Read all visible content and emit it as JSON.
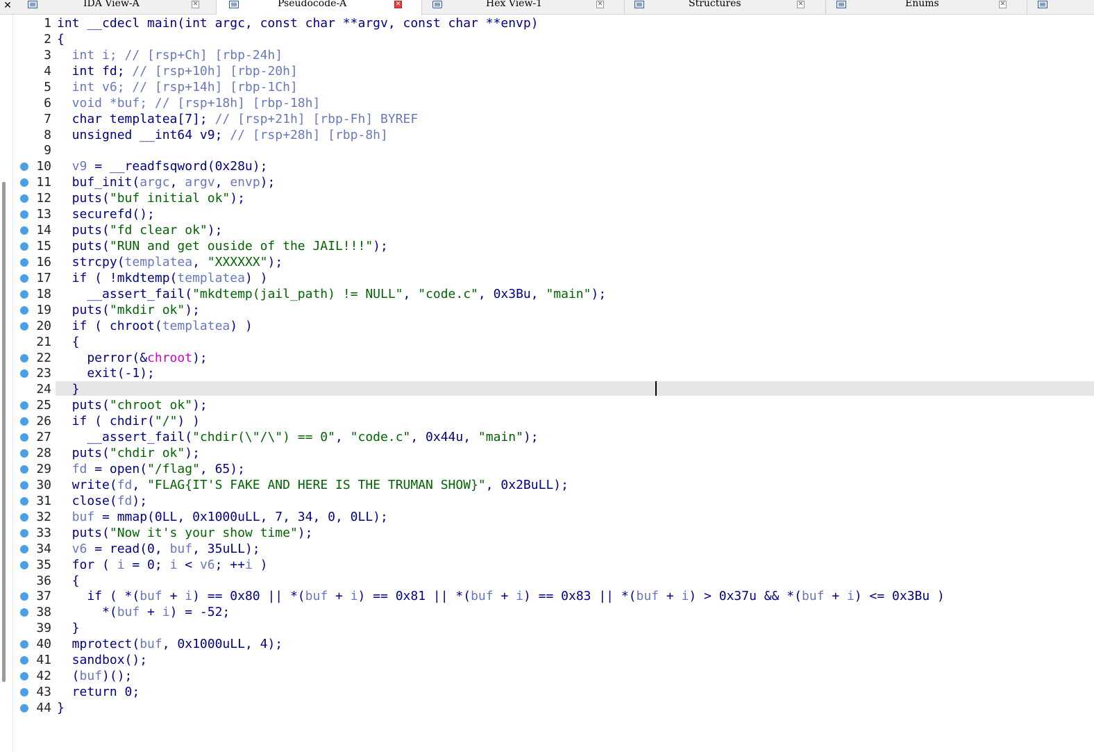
{
  "tabs": [
    {
      "label": "IDA View-A",
      "icon": "ida-view-icon",
      "active": false
    },
    {
      "label": "Pseudocode-A",
      "icon": "pseudocode-icon",
      "active": true
    },
    {
      "label": "Hex View-1",
      "icon": "hex-view-icon",
      "active": false
    },
    {
      "label": "Structures",
      "icon": "structures-icon",
      "active": false
    },
    {
      "label": "Enums",
      "icon": "enums-icon",
      "active": false
    }
  ],
  "colors": {
    "keyword": "#00008b",
    "variable": "#6878c0",
    "string": "#006400",
    "import": "#d000d0",
    "breakpoint": "#4aa0e8",
    "current_line": "#e6e6e6"
  },
  "lines": [
    {
      "n": "1",
      "bp": false,
      "t": [
        [
          "int __cdecl main(int argc, const char **argv, const char **envp)",
          "k"
        ]
      ]
    },
    {
      "n": "2",
      "bp": false,
      "t": [
        [
          "{",
          "k"
        ]
      ]
    },
    {
      "n": "3",
      "bp": false,
      "t": [
        [
          "  int i; // [rsp+Ch] [rbp-24h]",
          "g"
        ]
      ]
    },
    {
      "n": "4",
      "bp": false,
      "t": [
        [
          "  int fd; ",
          "k"
        ],
        [
          "// [rsp+10h] [rbp-20h]",
          "g"
        ]
      ]
    },
    {
      "n": "5",
      "bp": false,
      "t": [
        [
          "  int v6; // [rsp+14h] [rbp-1Ch]",
          "g"
        ]
      ]
    },
    {
      "n": "6",
      "bp": false,
      "t": [
        [
          "  void *buf; // [rsp+18h] [rbp-18h]",
          "g"
        ]
      ]
    },
    {
      "n": "7",
      "bp": false,
      "t": [
        [
          "  char templatea[7]; ",
          "k"
        ],
        [
          "// [rsp+21h] [rbp-Fh] BYREF",
          "g"
        ]
      ]
    },
    {
      "n": "8",
      "bp": false,
      "t": [
        [
          "  unsigned __int64 v9; ",
          "k"
        ],
        [
          "// [rsp+28h] [rbp-8h]",
          "g"
        ]
      ]
    },
    {
      "n": "9",
      "bp": false,
      "t": [
        [
          "",
          ""
        ]
      ]
    },
    {
      "n": "10",
      "bp": true,
      "t": [
        [
          "  v9",
          "g"
        ],
        [
          " = __readfsqword(0x28u);",
          "k"
        ]
      ]
    },
    {
      "n": "11",
      "bp": true,
      "t": [
        [
          "  buf_init(",
          "k"
        ],
        [
          "argc",
          "g"
        ],
        [
          ", ",
          "k"
        ],
        [
          "argv",
          "g"
        ],
        [
          ", ",
          "k"
        ],
        [
          "envp",
          "g"
        ],
        [
          ");",
          "k"
        ]
      ]
    },
    {
      "n": "12",
      "bp": true,
      "t": [
        [
          "  puts(",
          "k"
        ],
        [
          "\"buf initial ok\"",
          "s"
        ],
        [
          ");",
          "k"
        ]
      ]
    },
    {
      "n": "13",
      "bp": true,
      "t": [
        [
          "  securefd();",
          "k"
        ]
      ]
    },
    {
      "n": "14",
      "bp": true,
      "t": [
        [
          "  puts(",
          "k"
        ],
        [
          "\"fd clear ok\"",
          "s"
        ],
        [
          ");",
          "k"
        ]
      ]
    },
    {
      "n": "15",
      "bp": true,
      "t": [
        [
          "  puts(",
          "k"
        ],
        [
          "\"RUN and get ouside of the JAIL!!!\"",
          "s"
        ],
        [
          ");",
          "k"
        ]
      ]
    },
    {
      "n": "16",
      "bp": true,
      "t": [
        [
          "  strcpy(",
          "k"
        ],
        [
          "templatea",
          "g"
        ],
        [
          ", ",
          "k"
        ],
        [
          "\"XXXXXX\"",
          "s"
        ],
        [
          ");",
          "k"
        ]
      ]
    },
    {
      "n": "17",
      "bp": true,
      "t": [
        [
          "  if ( !mkdtemp(",
          "k"
        ],
        [
          "templatea",
          "g"
        ],
        [
          ") )",
          "k"
        ]
      ]
    },
    {
      "n": "18",
      "bp": true,
      "t": [
        [
          "    __assert_fail(",
          "k"
        ],
        [
          "\"mkdtemp(jail_path) != NULL\"",
          "s"
        ],
        [
          ", ",
          "k"
        ],
        [
          "\"code.c\"",
          "s"
        ],
        [
          ", 0x3Bu, ",
          "k"
        ],
        [
          "\"main\"",
          "s"
        ],
        [
          ");",
          "k"
        ]
      ]
    },
    {
      "n": "19",
      "bp": true,
      "t": [
        [
          "  puts(",
          "k"
        ],
        [
          "\"mkdir ok\"",
          "s"
        ],
        [
          ");",
          "k"
        ]
      ]
    },
    {
      "n": "20",
      "bp": true,
      "t": [
        [
          "  if ( chroot(",
          "k"
        ],
        [
          "templatea",
          "g"
        ],
        [
          ") )",
          "k"
        ]
      ]
    },
    {
      "n": "21",
      "bp": false,
      "t": [
        [
          "  {",
          "k"
        ]
      ]
    },
    {
      "n": "22",
      "bp": true,
      "t": [
        [
          "    perror(&",
          "k"
        ],
        [
          "chroot",
          "p"
        ],
        [
          ");",
          "k"
        ]
      ]
    },
    {
      "n": "23",
      "bp": true,
      "t": [
        [
          "    exit(-1);",
          "k"
        ]
      ]
    },
    {
      "n": "24",
      "bp": false,
      "t": [
        [
          "  }",
          "k"
        ]
      ]
    },
    {
      "n": "25",
      "bp": true,
      "t": [
        [
          "  puts(",
          "k"
        ],
        [
          "\"chroot ok\"",
          "s"
        ],
        [
          ");",
          "k"
        ]
      ]
    },
    {
      "n": "26",
      "bp": true,
      "t": [
        [
          "  if ( chdir(",
          "k"
        ],
        [
          "\"/\"",
          "s"
        ],
        [
          ") )",
          "k"
        ]
      ]
    },
    {
      "n": "27",
      "bp": true,
      "t": [
        [
          "    __assert_fail(",
          "k"
        ],
        [
          "\"chdir(\\\"/\\\") == 0\"",
          "s"
        ],
        [
          ", ",
          "k"
        ],
        [
          "\"code.c\"",
          "s"
        ],
        [
          ", 0x44u, ",
          "k"
        ],
        [
          "\"main\"",
          "s"
        ],
        [
          ");",
          "k"
        ]
      ]
    },
    {
      "n": "28",
      "bp": true,
      "t": [
        [
          "  puts(",
          "k"
        ],
        [
          "\"chdir ok\"",
          "s"
        ],
        [
          ");",
          "k"
        ]
      ]
    },
    {
      "n": "29",
      "bp": true,
      "t": [
        [
          "  fd",
          "g"
        ],
        [
          " = open(",
          "k"
        ],
        [
          "\"/flag\"",
          "s"
        ],
        [
          ", 65);",
          "k"
        ]
      ]
    },
    {
      "n": "30",
      "bp": true,
      "t": [
        [
          "  write(",
          "k"
        ],
        [
          "fd",
          "g"
        ],
        [
          ", ",
          "k"
        ],
        [
          "\"FLAG{IT'S FAKE AND HERE IS THE TRUMAN SHOW}\"",
          "s"
        ],
        [
          ", 0x2BuLL);",
          "k"
        ]
      ]
    },
    {
      "n": "31",
      "bp": true,
      "t": [
        [
          "  close(",
          "k"
        ],
        [
          "fd",
          "g"
        ],
        [
          ");",
          "k"
        ]
      ]
    },
    {
      "n": "32",
      "bp": true,
      "t": [
        [
          "  buf",
          "g"
        ],
        [
          " = mmap(0LL, 0x1000uLL, 7, 34, 0, 0LL);",
          "k"
        ]
      ]
    },
    {
      "n": "33",
      "bp": true,
      "t": [
        [
          "  puts(",
          "k"
        ],
        [
          "\"Now it's your show time\"",
          "s"
        ],
        [
          ");",
          "k"
        ]
      ]
    },
    {
      "n": "34",
      "bp": true,
      "t": [
        [
          "  v6",
          "g"
        ],
        [
          " = read(0, ",
          "k"
        ],
        [
          "buf",
          "g"
        ],
        [
          ", 35uLL);",
          "k"
        ]
      ]
    },
    {
      "n": "35",
      "bp": true,
      "t": [
        [
          "  for ( ",
          "k"
        ],
        [
          "i",
          "g"
        ],
        [
          " = 0; ",
          "k"
        ],
        [
          "i",
          "g"
        ],
        [
          " < ",
          "k"
        ],
        [
          "v6",
          "g"
        ],
        [
          "; ++",
          "k"
        ],
        [
          "i",
          "g"
        ],
        [
          " )",
          "k"
        ]
      ]
    },
    {
      "n": "36",
      "bp": false,
      "t": [
        [
          "  {",
          "k"
        ]
      ]
    },
    {
      "n": "37",
      "bp": true,
      "t": [
        [
          "    if ( *(",
          "k"
        ],
        [
          "buf",
          "g"
        ],
        [
          " + ",
          "k"
        ],
        [
          "i",
          "g"
        ],
        [
          ") == 0x80 || *(",
          "k"
        ],
        [
          "buf",
          "g"
        ],
        [
          " + ",
          "k"
        ],
        [
          "i",
          "g"
        ],
        [
          ") == 0x81 || *(",
          "k"
        ],
        [
          "buf",
          "g"
        ],
        [
          " + ",
          "k"
        ],
        [
          "i",
          "g"
        ],
        [
          ") == 0x83 || *(",
          "k"
        ],
        [
          "buf",
          "g"
        ],
        [
          " + ",
          "k"
        ],
        [
          "i",
          "g"
        ],
        [
          ") > 0x37u && *(",
          "k"
        ],
        [
          "buf",
          "g"
        ],
        [
          " + ",
          "k"
        ],
        [
          "i",
          "g"
        ],
        [
          ") <= 0x3Bu )",
          "k"
        ]
      ]
    },
    {
      "n": "38",
      "bp": true,
      "t": [
        [
          "      *(",
          "k"
        ],
        [
          "buf",
          "g"
        ],
        [
          " + ",
          "k"
        ],
        [
          "i",
          "g"
        ],
        [
          ") = -52;",
          "k"
        ]
      ]
    },
    {
      "n": "39",
      "bp": false,
      "t": [
        [
          "  }",
          "k"
        ]
      ]
    },
    {
      "n": "40",
      "bp": true,
      "t": [
        [
          "  mprotect(",
          "k"
        ],
        [
          "buf",
          "g"
        ],
        [
          ", 0x1000uLL, 4);",
          "k"
        ]
      ]
    },
    {
      "n": "41",
      "bp": true,
      "t": [
        [
          "  sandbox();",
          "k"
        ]
      ]
    },
    {
      "n": "42",
      "bp": true,
      "t": [
        [
          "  (",
          "k"
        ],
        [
          "buf",
          "g"
        ],
        [
          ")();",
          "k"
        ]
      ]
    },
    {
      "n": "43",
      "bp": true,
      "t": [
        [
          "  return 0;",
          "k"
        ]
      ]
    },
    {
      "n": "44",
      "bp": true,
      "t": [
        [
          "}",
          "k"
        ]
      ]
    }
  ],
  "current_line": "24"
}
